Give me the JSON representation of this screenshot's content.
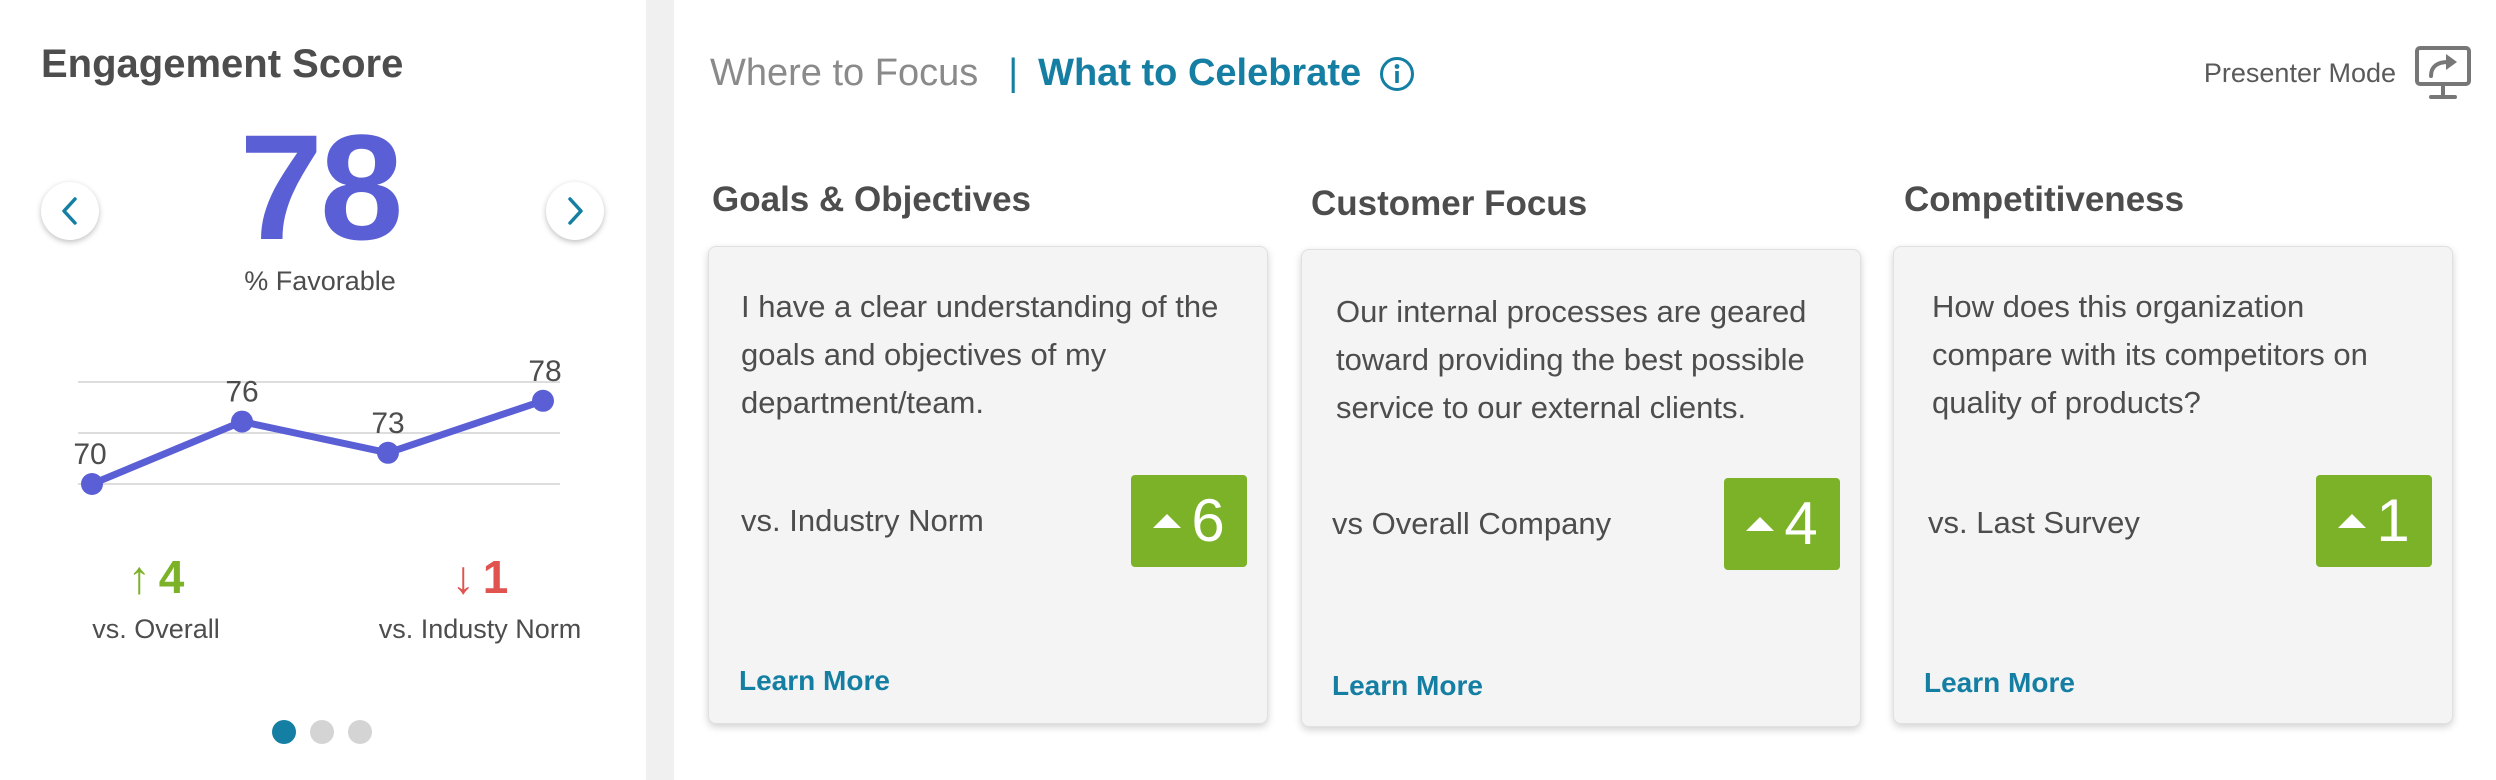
{
  "engagement": {
    "title": "Engagement Score",
    "score": "78",
    "caption": "% Favorable",
    "trend": {
      "values": [
        70,
        76,
        73,
        78
      ],
      "labels": [
        "70",
        "76",
        "73",
        "78"
      ],
      "line_color": "#5b5fd6"
    },
    "deltas": [
      {
        "arrow": "↑",
        "value": "4",
        "label": "vs. Overall",
        "direction": "up",
        "color": "#7cb228"
      },
      {
        "arrow": "↓",
        "value": "1",
        "label": "vs. Industy Norm",
        "direction": "down",
        "color": "#e0534f"
      }
    ],
    "pagination": {
      "total": 3,
      "active": 1
    }
  },
  "tabs": {
    "where_to_focus": "Where to Focus",
    "separator": "|",
    "what_to_celebrate": "What to Celebrate",
    "active": "what_to_celebrate"
  },
  "presenter_mode": {
    "label": "Presenter Mode",
    "icon": "presenter-screen-icon"
  },
  "cards": [
    {
      "category": "Goals & Objectives",
      "question": "I have a clear understanding of the goals and objectives of my department/team.",
      "comparison": "vs. Industry Norm",
      "delta": "6",
      "link": "Learn More"
    },
    {
      "category": "Customer Focus",
      "question": "Our internal processes are geared toward providing the best possible service to our external clients.",
      "comparison": "vs Overall Company",
      "delta": "4",
      "link": "Learn More"
    },
    {
      "category": "Competitiveness",
      "question": "How does this organization compare with its competitors on quality of products?",
      "comparison": "vs. Last Survey",
      "delta": "1",
      "link": "Learn More"
    }
  ],
  "colors": {
    "accent": "#147fa3",
    "score_purple": "#5b5fd6",
    "positive_green": "#7cb228",
    "negative_red": "#e0534f"
  }
}
